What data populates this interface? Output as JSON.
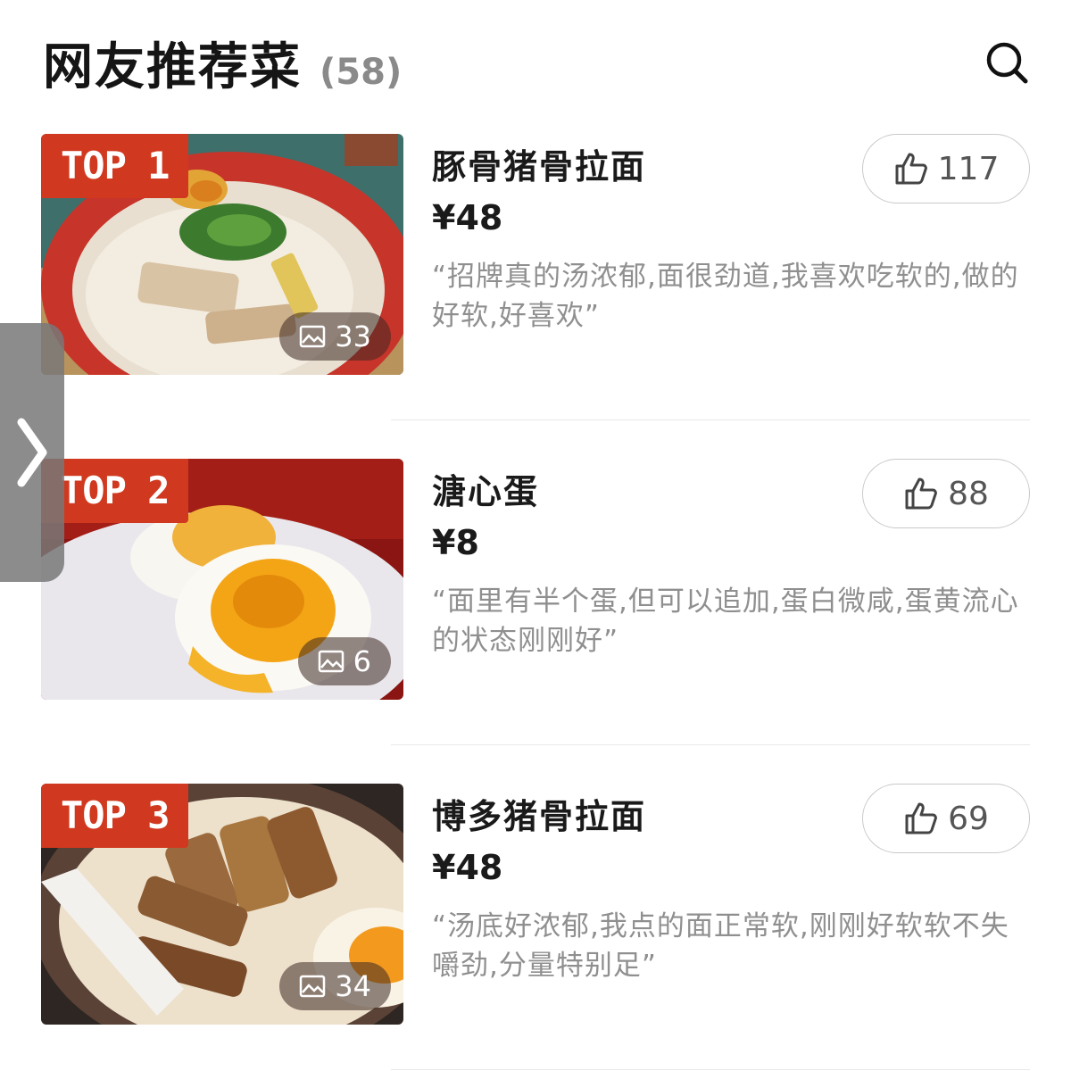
{
  "header": {
    "title": "网友推荐菜",
    "count": "(58)",
    "search_icon": "search-icon"
  },
  "side_handle": {
    "icon": "chevron-right-icon"
  },
  "dishes": [
    {
      "rank": "TOP 1",
      "name": "豚骨猪骨拉面",
      "price": "¥48",
      "review": "“招牌真的汤浓郁,面很劲道,我喜欢吃软的,做的好软,好喜欢”",
      "likes": "117",
      "photo_count": "33"
    },
    {
      "rank": "TOP 2",
      "name": "溏心蛋",
      "price": "¥8",
      "review": "“面里有半个蛋,但可以追加,蛋白微咸,蛋黄流心的状态刚刚好”",
      "likes": "88",
      "photo_count": "6"
    },
    {
      "rank": "TOP 3",
      "name": "博多猪骨拉面",
      "price": "¥48",
      "review": "“汤底好浓郁,我点的面正常软,刚刚好软软不失嚼劲,分量特别足”",
      "likes": "69",
      "photo_count": "34"
    }
  ],
  "colors": {
    "badge": "#d0391f",
    "text_primary": "#1a1a1a",
    "text_secondary": "#8f8f8f"
  }
}
